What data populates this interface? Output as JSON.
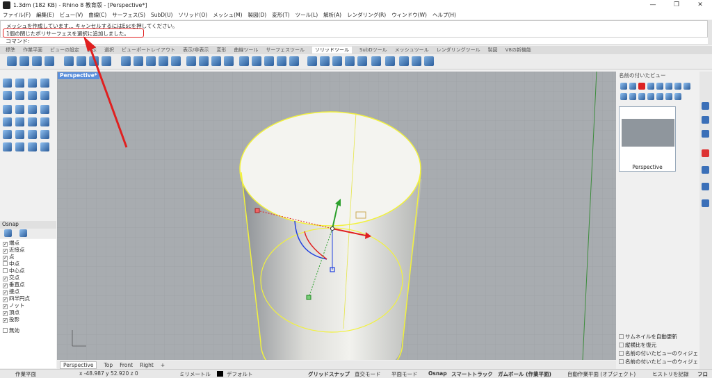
{
  "window": {
    "title": "1.3dm (182 KB) - Rhino 8 教育版 - [Perspective*]",
    "controls": [
      "—",
      "❐",
      "✕"
    ]
  },
  "menu": [
    "ファイル(F)",
    "編集(E)",
    "ビュー(V)",
    "曲線(C)",
    "サーフェス(S)",
    "SubD(U)",
    "ソリッド(O)",
    "メッシュ(M)",
    "製図(D)",
    "変形(T)",
    "ツール(L)",
    "解析(A)",
    "レンダリング(R)",
    "ウィンドウ(W)",
    "ヘルプ(H)"
  ],
  "command": {
    "line1": "メッシュを作成しています... キャンセルするにはEscを押してください。",
    "line2": "1個の閉じたポリサーフェスを選択に追加しました。",
    "prompt": "コマンド:"
  },
  "tabs": [
    "標準",
    "作業平面",
    "ビューの設定",
    "表示",
    "選択",
    "ビューポートレイアウト",
    "表示/非表示",
    "変形",
    "曲線ツール",
    "サーフェスツール",
    "ソリッドツール",
    "SubDツール",
    "メッシュツール",
    "レンダリングツール",
    "製図",
    "V8の新機能"
  ],
  "active_tab": "ソリッドツール",
  "viewport": {
    "label": "Perspective*",
    "tabs": [
      "Perspective",
      "Top",
      "Front",
      "Right",
      "+"
    ]
  },
  "osnap": {
    "title": "Osnap",
    "items": [
      {
        "label": "端点",
        "checked": true
      },
      {
        "label": "近接点",
        "checked": true
      },
      {
        "label": "点",
        "checked": true
      },
      {
        "label": "中点",
        "checked": false
      },
      {
        "label": "中心点",
        "checked": false
      },
      {
        "label": "交点",
        "checked": true
      },
      {
        "label": "垂直点",
        "checked": true
      },
      {
        "label": "接点",
        "checked": true
      },
      {
        "label": "四半円点",
        "checked": true
      },
      {
        "label": "ノット",
        "checked": true
      },
      {
        "label": "頂点",
        "checked": true
      },
      {
        "label": "投影",
        "checked": true
      },
      {
        "label": "無効",
        "checked": false
      }
    ]
  },
  "named_views": {
    "title": "名前の付いたビュー",
    "thumb_label": "Perspective",
    "options": [
      "サムネイルを自動更新",
      "縦横比を復元",
      "名前の付いたビューのウィジェ",
      "名前の付いたビューのウィジェ"
    ]
  },
  "status": {
    "cplane": "作業平面",
    "coords": "x -48.987  y 52.920  z 0",
    "units": "ミリメートル",
    "layer": "デフォルト",
    "grid_snap": "グリッドスナップ",
    "ortho": "直交モード",
    "planar": "平面モード",
    "osnap": "Osnap",
    "smart_track": "スマートトラック",
    "gumball": "ガムボール (作業平面)",
    "auto_cplane": "自動作業平面 (オブジェクト)",
    "history": "ヒストリを記録",
    "filter": "フロ"
  },
  "colors": {
    "selection_yellow": "#f2f23c",
    "annotation_red": "#e02020",
    "viewport_bg": "#a8acb0"
  }
}
